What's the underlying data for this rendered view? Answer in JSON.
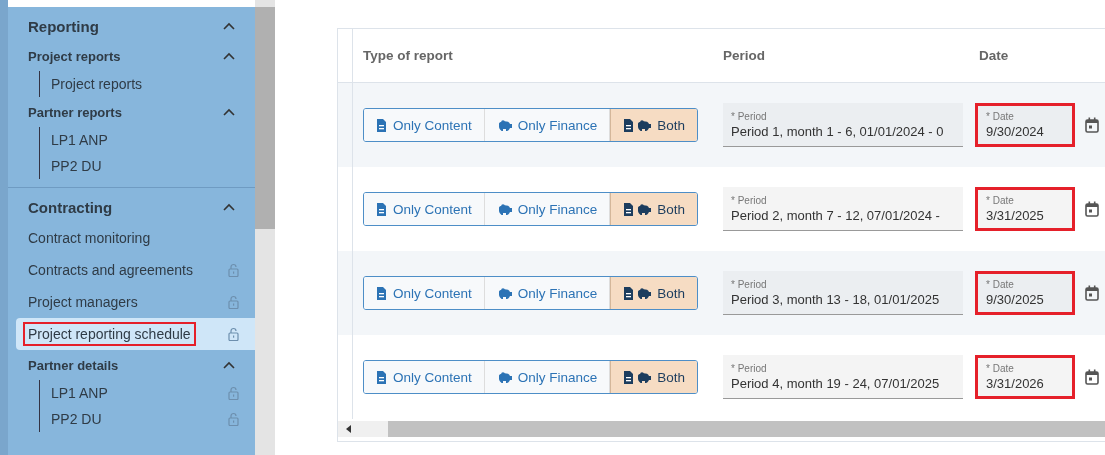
{
  "sidebar": {
    "sections": [
      {
        "title": "Reporting",
        "expanded": true,
        "children": [
          {
            "kind": "group",
            "label": "Project reports",
            "expanded": true,
            "children": [
              {
                "label": "Project reports",
                "locked": false,
                "selected": false,
                "highlighted": false
              }
            ]
          },
          {
            "kind": "group",
            "label": "Partner reports",
            "expanded": true,
            "children": [
              {
                "label": "LP1 ANP",
                "locked": false,
                "selected": false,
                "highlighted": false
              },
              {
                "label": "PP2 DU",
                "locked": false,
                "selected": false,
                "highlighted": false
              }
            ]
          }
        ]
      },
      {
        "title": "Contracting",
        "expanded": true,
        "children": [
          {
            "kind": "item",
            "label": "Contract monitoring",
            "locked": false,
            "selected": false,
            "highlighted": false
          },
          {
            "kind": "item",
            "label": "Contracts and agreements",
            "locked": true,
            "selected": false,
            "highlighted": false
          },
          {
            "kind": "item",
            "label": "Project managers",
            "locked": true,
            "selected": false,
            "highlighted": false
          },
          {
            "kind": "item",
            "label": "Project reporting schedule",
            "locked": true,
            "selected": true,
            "highlighted": true
          },
          {
            "kind": "group",
            "label": "Partner details",
            "expanded": true,
            "children": [
              {
                "label": "LP1 ANP",
                "locked": true,
                "selected": false,
                "highlighted": false
              },
              {
                "label": "PP2 DU",
                "locked": true,
                "selected": false,
                "highlighted": false
              }
            ]
          }
        ]
      }
    ]
  },
  "table": {
    "columns": [
      "Type of report",
      "Period",
      "Date"
    ],
    "rows": [
      {
        "type_options": [
          {
            "label": "Only Content",
            "kind": "content",
            "selected": false
          },
          {
            "label": "Only Finance",
            "kind": "finance",
            "selected": false
          },
          {
            "label": "Both",
            "kind": "both",
            "selected": true
          }
        ],
        "period_label": "* Period",
        "period": "Period 1, month 1 - 6, 01/01/2024 - 0",
        "date_label": "* Date",
        "date": "9/30/2024",
        "date_highlighted": true
      },
      {
        "type_options": [
          {
            "label": "Only Content",
            "kind": "content",
            "selected": false
          },
          {
            "label": "Only Finance",
            "kind": "finance",
            "selected": false
          },
          {
            "label": "Both",
            "kind": "both",
            "selected": true
          }
        ],
        "period_label": "* Period",
        "period": "Period 2, month 7 - 12, 07/01/2024 -",
        "date_label": "* Date",
        "date": "3/31/2025",
        "date_highlighted": true
      },
      {
        "type_options": [
          {
            "label": "Only Content",
            "kind": "content",
            "selected": false
          },
          {
            "label": "Only Finance",
            "kind": "finance",
            "selected": false
          },
          {
            "label": "Both",
            "kind": "both",
            "selected": true
          }
        ],
        "period_label": "* Period",
        "period": "Period 3, month 13 - 18, 01/01/2025",
        "date_label": "* Date",
        "date": "9/30/2025",
        "date_highlighted": true
      },
      {
        "type_options": [
          {
            "label": "Only Content",
            "kind": "content",
            "selected": false
          },
          {
            "label": "Only Finance",
            "kind": "finance",
            "selected": false
          },
          {
            "label": "Both",
            "kind": "both",
            "selected": true
          }
        ],
        "period_label": "* Period",
        "period": "Period 4, month 19 - 24, 07/01/2025",
        "date_label": "* Date",
        "date": "3/31/2026",
        "date_highlighted": true
      }
    ]
  }
}
